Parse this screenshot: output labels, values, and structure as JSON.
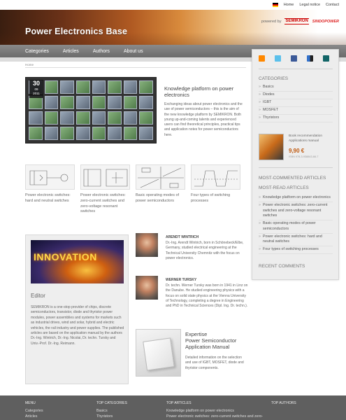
{
  "topnav": {
    "home": "Home",
    "legal": "Legal notice",
    "contact": "Contact"
  },
  "header": {
    "site_title": "Power Electronics Base",
    "powered_by": "powered by",
    "logo_semikron": "SEMIKRON",
    "logo_sindopower": "SINDOPOWER"
  },
  "mainnav": [
    {
      "label": "Categories"
    },
    {
      "label": "Articles"
    },
    {
      "label": "Authors"
    },
    {
      "label": "About us"
    }
  ],
  "breadcrumb": "Home",
  "feature": {
    "date_day": "30",
    "date_month": "09",
    "date_year": "2011",
    "title": "Knowledge platform on power electronics",
    "text": "Exchanging ideas about power electronics and the use of power semiconductors – this is the aim of the new knowledge platform by SEMIKRON. Both young up-and-coming talents and experienced users can find theoretical principles, practical tips and application notes for power semiconductors here."
  },
  "thumbs": [
    {
      "caption": "Power electronic switches: hard and neutral switches"
    },
    {
      "caption": "Power electronic switches: zero-current switches and zero-voltage resonant switches"
    },
    {
      "caption": "Basic operating modes of power semiconductors"
    },
    {
      "caption": "Four types of switching processes"
    }
  ],
  "editor": {
    "image_word": "INNOVATION",
    "title": "Editor",
    "text": "SEMIKRON is a one-stop provider of chips, discrete semiconductors, transistor, diode and thyristor power modules, power assemblies and systems for markets such as industrial drives, wind and solar, hybrid and electric vehicles, the rail industry and power supplies. The published articles are based on the application manual by the authors Dr.-Ing. Wintrich, Dr.-Ing. Nicolai, Dr. techn. Tursky and Univ.-Prof. Dr.-Ing. Reimann."
  },
  "authors": [
    {
      "name": "ARENDT WINTRICH",
      "bio": "Dr.-Ing. Arendt Wintrich, born in Schönebeck/Elbe, Germany, studied electrical engineering at the Technical University Chemnitz with the focus on power electronics."
    },
    {
      "name": "WERNER TURSKY",
      "bio": "Dr. techn. Werner Tursky was born in 1941 in Linz on the Danube. He studied engineering physics with a focus on solid state physics at the Vienna University of Technology, completing a degree in Engineering and PhD in Technical Sciences (Dipl. Ing. Dr. techn.)."
    }
  ],
  "expertise": {
    "title": "Expertise\nPower Semiconductor Application Manual",
    "text": "Detailed information on the selection and use of IGBT, MOSFET, diode and thyristor components."
  },
  "sidebar": {
    "categories_head": "CATEGORIES",
    "categories": [
      "Basics",
      "Diodes",
      "IGBT",
      "MOSFET",
      "Thyristors"
    ],
    "book_label": "Book recommendation Applications manual",
    "book_price": "9,90 €",
    "book_isbn": "ISBN 978-3-938843-66-7",
    "most_commented_head": "MOST-COMMENTED ARTICLES",
    "most_read_head": "MOST-READ ARTICLES",
    "most_read": [
      "Knowledge platform on power electronics",
      "Power electronic switches: zero-current switches and zero-voltage resonant switches",
      "Basic operating modes of power semiconductors",
      "Power electronic switches: hard and neutral switches",
      "Four types of switching processes"
    ],
    "recent_comments_head": "RECENT COMMENTS"
  },
  "footer": {
    "menu_head": "MENU",
    "menu": [
      "Categories",
      "Articles"
    ],
    "top_categories_head": "TOP CATEGORIES",
    "top_categories": [
      "Basics",
      "Thyristors"
    ],
    "top_articles_head": "TOP ARTICLES",
    "top_articles": [
      "Knowledge platform on power electronics",
      "Power electronic switches: zero-current switches and zero-"
    ],
    "top_authors_head": "TOP AUTHORS"
  }
}
